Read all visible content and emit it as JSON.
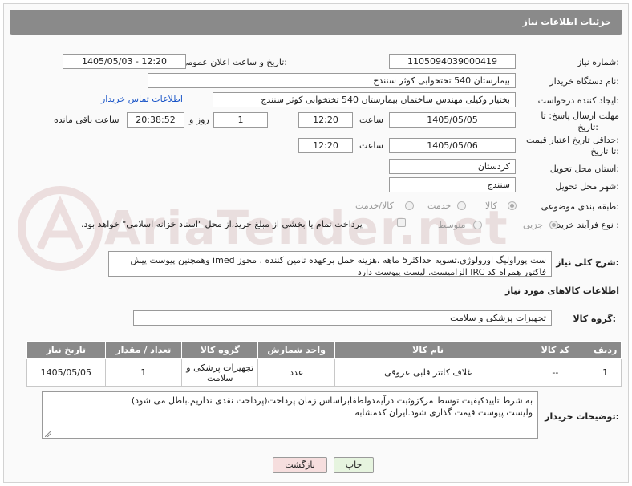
{
  "header": {
    "title": "جزئیات اطلاعات نیاز"
  },
  "form": {
    "need_number_label": "شماره نیاز:",
    "need_number": "1105094039000419",
    "announce_label": "تاریخ و ساعت اعلان عمومی:",
    "announce_value": "1405/05/03 - 12:20",
    "buyer_org_label": "نام دستگاه خریدار:",
    "buyer_org": "بیمارستان 540 تختخوابی کوثر سنندج",
    "creator_label": "ایجاد کننده درخواست:",
    "creator": "بختیار وکیلی مهندس ساختمان بیمارستان 540 تختخوابی کوثر سنندج",
    "contact_link": "اطلاعات تماس خریدار",
    "deadline_label_1": "مهلت ارسال پاسخ: تا",
    "deadline_label_2": "تاریخ:",
    "deadline_date": "1405/05/05",
    "time_label": "ساعت",
    "deadline_time": "12:20",
    "days_value": "1",
    "days_label": "روز و",
    "remaining_time": "20:38:52",
    "remaining_label": "ساعت باقی مانده",
    "validity_label_1": "حداقل تاریخ اعتبار قیمت:",
    "validity_label_2": "تا تاریخ:",
    "validity_date": "1405/05/06",
    "validity_time": "12:20",
    "province_label": "استان محل تحویل:",
    "province": "کردستان",
    "city_label": "شهر محل تحویل:",
    "city": "سنندج",
    "category_label": "طبقه بندی موضوعی:",
    "category_options": [
      "کالا",
      "خدمت",
      "کالا/خدمت"
    ],
    "purchase_type_label": "نوع فرآیند خرید :",
    "purchase_options": [
      "جزیی",
      "متوسط"
    ],
    "payment_note": "پرداخت تمام یا بخشی از مبلغ خرید،از محل \"اسناد خزانه اسلامی\" خواهد بود."
  },
  "description": {
    "label": "شرح کلی نیاز:",
    "text": "ست پوراولیگ اورولوژی.تسویه حداکثر5 ماهه .هزینه حمل برعهده تامین کننده . مجوز imed وهمچنین پیوست پیش فاکتور همراه کد IRC  الزامیست. لیست پیوست دارد"
  },
  "goods": {
    "section_title": "اطلاعات کالاهای مورد نیاز",
    "group_label": "گروه کالا:",
    "group_value": "تجهیزات پزشکی و سلامت",
    "columns": [
      "ردیف",
      "کد کالا",
      "نام کالا",
      "واحد شمارش",
      "گروه کالا",
      "تعداد / مقدار",
      "تاریخ نیاز"
    ],
    "rows": [
      {
        "row": "1",
        "code": "--",
        "name": "غلاف کاتتر قلبی عروقی",
        "unit": "عدد",
        "group": "تجهیزات پزشکی و سلامت",
        "qty": "1",
        "date": "1405/05/05"
      }
    ]
  },
  "buyer_notes": {
    "label": "توضیحات خریدار:",
    "line1": "به شرط تاییدکیفیت توسط مرکزوثبت درآیمدولطفابراساس زمان پرداخت(پرداخت نقدی نداریم.باطل می شود)",
    "line2": "ولیست پیوست قیمت گذاری شود.ایران کدمشابه"
  },
  "buttons": {
    "print": "چاپ",
    "back": "بازگشت"
  },
  "watermark": {
    "text": "AriaTender.net"
  },
  "colors": {
    "header_bg": "#8a8a8a",
    "link": "#1a55c8",
    "back_btn": "#f6dede",
    "print_btn": "#e6f4df"
  }
}
